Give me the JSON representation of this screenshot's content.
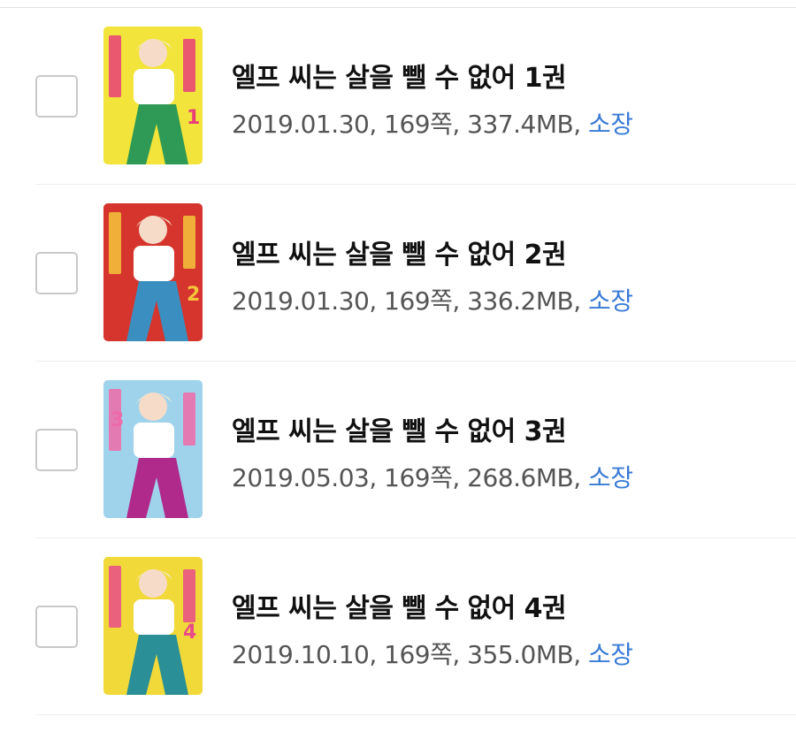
{
  "books": [
    {
      "title": "엘프 씨는 살을 뺄 수 없어 1권",
      "date": "2019.01.30",
      "pages": "169쪽",
      "size": "337.4MB",
      "status": "소장",
      "cover": {
        "bg": "#f2e43a",
        "accent": "#2e9a55",
        "text": "#e83f79",
        "volume": "1"
      }
    },
    {
      "title": "엘프 씨는 살을 뺄 수 없어 2권",
      "date": "2019.01.30",
      "pages": "169쪽",
      "size": "336.2MB",
      "status": "소장",
      "cover": {
        "bg": "#d6352e",
        "accent": "#3a8fc0",
        "text": "#f4c43a",
        "volume": "2"
      }
    },
    {
      "title": "엘프 씨는 살을 뺄 수 없어 3권",
      "date": "2019.05.03",
      "pages": "169쪽",
      "size": "268.6MB",
      "status": "소장",
      "cover": {
        "bg": "#9fd3ec",
        "accent": "#b02a8c",
        "text": "#ef6aa8",
        "volume": "3"
      }
    },
    {
      "title": "엘프 씨는 살을 뺄 수 없어 4권",
      "date": "2019.10.10",
      "pages": "169쪽",
      "size": "355.0MB",
      "status": "소장",
      "cover": {
        "bg": "#f2d93a",
        "accent": "#2a8f96",
        "text": "#e84b8a",
        "volume": "4"
      }
    }
  ],
  "meta_separator": ", ",
  "colors": {
    "link": "#3a7bd5",
    "title": "#111111",
    "meta": "#555555",
    "divider": "#ededed"
  }
}
